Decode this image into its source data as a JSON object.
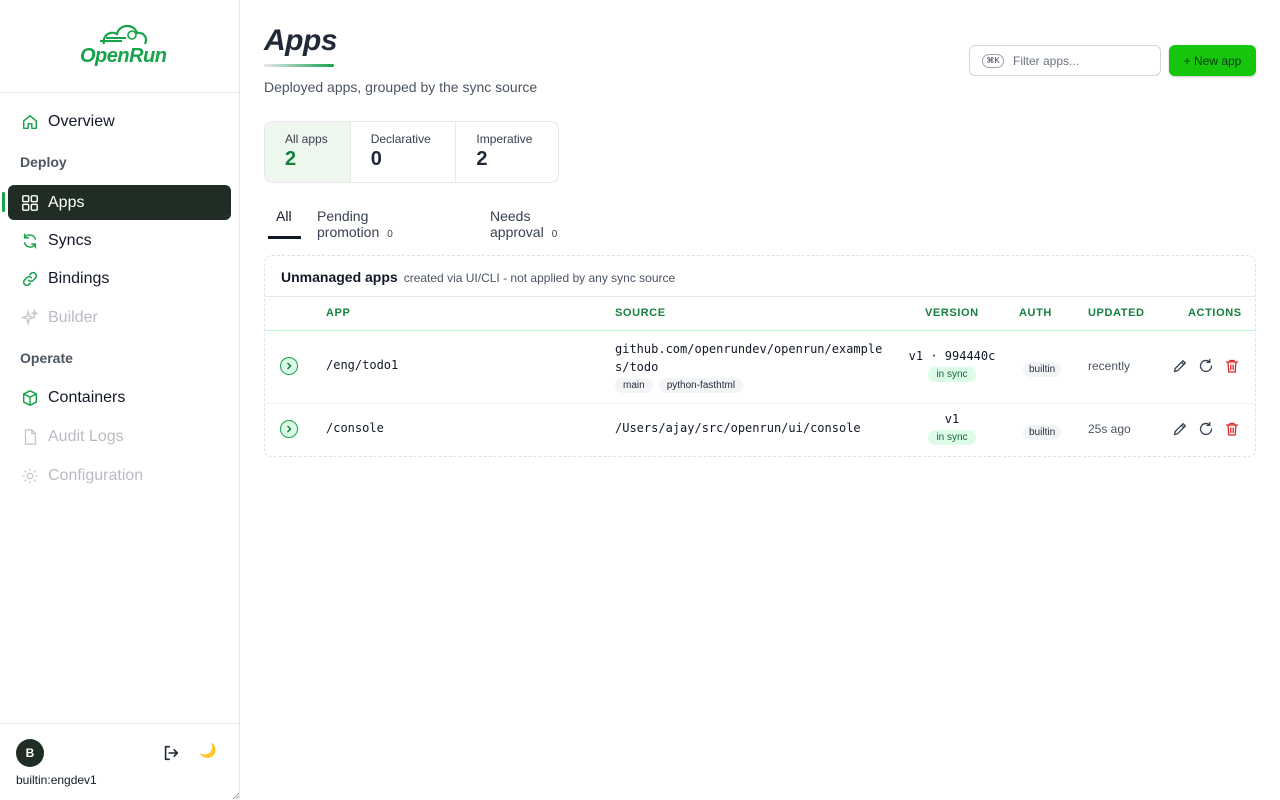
{
  "brand": {
    "name": "OpenRun",
    "color": "#16a34a"
  },
  "sidebar": {
    "overview": "Overview",
    "deploy_label": "Deploy",
    "apps": "Apps",
    "syncs": "Syncs",
    "bindings": "Bindings",
    "builder": "Builder",
    "operate_label": "Operate",
    "containers": "Containers",
    "audit_logs": "Audit Logs",
    "configuration": "Configuration"
  },
  "user": {
    "initial": "B",
    "name": "builtin:engdev1"
  },
  "page": {
    "title": "Apps",
    "subtitle": "Deployed apps, grouped by the sync source",
    "search_placeholder": "Filter apps...",
    "search_kbd": "⌘K",
    "new_app": "+ New app"
  },
  "stats": [
    {
      "label": "All apps",
      "value": "2"
    },
    {
      "label": "Declarative",
      "value": "0"
    },
    {
      "label": "Imperative",
      "value": "2"
    }
  ],
  "tabs": [
    {
      "label": "All",
      "count": ""
    },
    {
      "label": "Pending promotion",
      "count": "0"
    },
    {
      "label": "Needs approval",
      "count": "0"
    }
  ],
  "panel": {
    "title": "Unmanaged apps",
    "note": "created via UI/CLI - not applied by any sync source",
    "columns": {
      "app": "APP",
      "source": "SOURCE",
      "version": "VERSION",
      "auth": "AUTH",
      "updated": "UPDATED",
      "actions": "ACTIONS"
    },
    "rows": [
      {
        "app": "/eng/todo1",
        "source_line1": "github.com/openrundev/openrun/example",
        "source_line2": "s/todo",
        "tags": [
          "main",
          "python-fasthtml"
        ],
        "version": "v1 · 994440c",
        "status": "in sync",
        "auth": "builtin",
        "updated": "recently"
      },
      {
        "app": "/console",
        "source_line1": "/Users/ajay/src/openrun/ui/console",
        "version": "v1",
        "status": "in sync",
        "auth": "builtin",
        "updated": "25s ago"
      }
    ]
  },
  "colors": {
    "accent": "#16a34a",
    "active_nav": "#1f2d25",
    "primary_button": "#16c60c",
    "delete": "#dc2626"
  }
}
